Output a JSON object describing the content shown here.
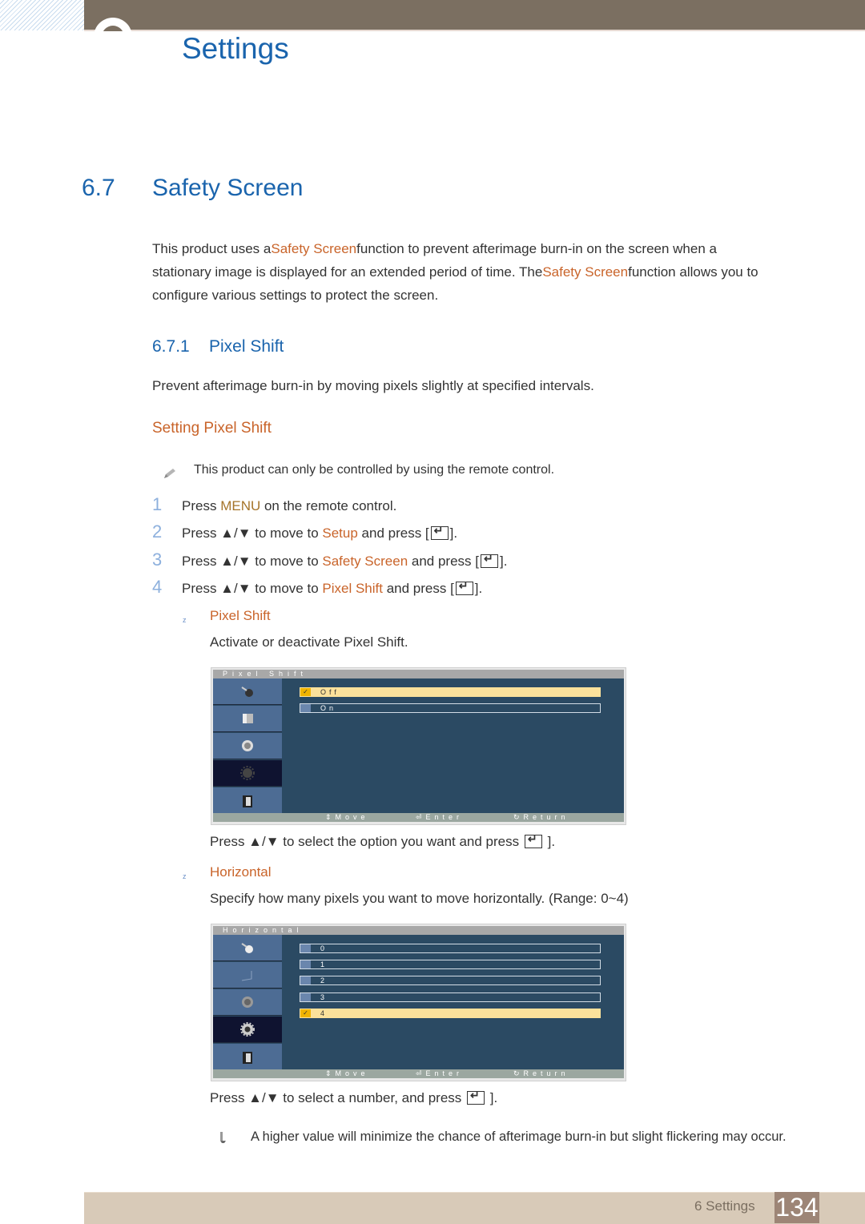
{
  "header": {
    "chapter_title": "Settings"
  },
  "section": {
    "number": "6.7",
    "title": "Safety Screen",
    "intro": {
      "part1": "This product uses a",
      "link1": "Safety Screen",
      "part2": "function to prevent afterimage burn-in on the screen when a",
      "part3": "stationary image is displayed for an extended period of time. The",
      "link2": "Safety Screen",
      "part4": "function allows you to",
      "part5": "configure various settings to protect the screen."
    }
  },
  "subsection": {
    "number": "6.7.1",
    "title": "Pixel Shift",
    "lead": "Prevent afterimage burn-in by moving pixels slightly at specified intervals.",
    "procedure_title": "Setting Pixel Shift",
    "note": "This product can only be controlled by using the remote control."
  },
  "steps": [
    {
      "num": "1",
      "pre": "Press ",
      "key": "MENU",
      "post": " on the remote control."
    },
    {
      "num": "2",
      "pre": "Press ▲/▼ to move to ",
      "key": "Setup",
      "post": " and press [",
      "end": "]."
    },
    {
      "num": "3",
      "pre": "Press ▲/▼ to move to ",
      "key": "Safety Screen",
      "post": " and press [",
      "end": "]."
    },
    {
      "num": "4",
      "pre": "Press ▲/▼ to move to ",
      "key": "Pixel Shift",
      "post": " and press [",
      "end": "]."
    }
  ],
  "items": [
    {
      "bullet": "z",
      "title": "Pixel Shift",
      "desc": "Activate or deactivate Pixel Shift.",
      "osd": {
        "title": "Pixel Shift",
        "options": [
          "Off",
          "On"
        ],
        "selected": "Off",
        "footer": {
          "move": "Move",
          "enter": "Enter",
          "return": "Return"
        }
      },
      "instruction_pre": "Press ▲/▼ to select the option you want and press ",
      "instruction_end": "]."
    },
    {
      "bullet": "z",
      "title": "Horizontal",
      "desc": "Specify how many pixels you want to move horizontally. (Range: 0~4)",
      "osd": {
        "title": "Horizontal",
        "options": [
          "0",
          "1",
          "2",
          "3",
          "4"
        ],
        "selected": "4",
        "footer": {
          "move": "Move",
          "enter": "Enter",
          "return": "Return"
        }
      },
      "instruction_pre": "Press ▲/▼ to select a number, and press ",
      "instruction_end": "]."
    }
  ],
  "final_note": "A higher value will minimize the chance of afterimage burn-in but slight flickering may occur.",
  "footer": {
    "chapter": "6 Settings",
    "page": "134"
  },
  "colors": {
    "heading_blue": "#1a64ad",
    "accent_orange": "#c9642a",
    "header_brown": "#7b6f61",
    "osd_background": "#2b4a63",
    "osd_selected": "#fbe19b"
  }
}
